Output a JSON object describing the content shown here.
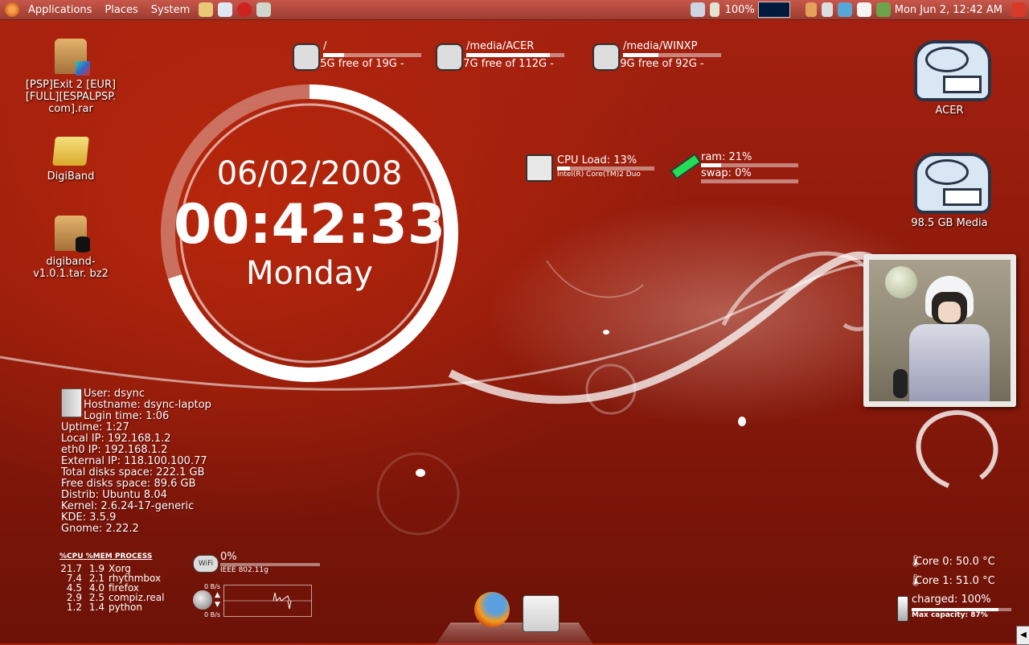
{
  "panel": {
    "menu": [
      "Applications",
      "Places",
      "System"
    ],
    "battery": "100%",
    "clock": "Mon Jun  2, 12:42 AM"
  },
  "desktop_icons": [
    {
      "label": "[PSP]Exit 2 [EUR] [FULL][ESPALPSP. com].rar"
    },
    {
      "label": "DigiBand"
    },
    {
      "label": "digiband-v1.0.1.tar. bz2"
    },
    {
      "label": "ACER"
    },
    {
      "label": "98.5 GB Media"
    }
  ],
  "disks": [
    {
      "path": "/",
      "usage": "15G free of 19G -",
      "used_fraction": 0.21
    },
    {
      "path": "/media/ACER",
      "usage": "17G free of 112G -",
      "used_fraction": 0.85
    },
    {
      "path": "/media/WINXP",
      "usage": "59G free of 92G -",
      "used_fraction": 0.36
    }
  ],
  "clock_widget": {
    "date": "06/02/2008",
    "time": "00:42:33",
    "day": "Monday",
    "ring_fraction": 0.7
  },
  "cpu": {
    "label": "CPU Load: 13%",
    "model": "Intel(R) Core(TM)2 Duo",
    "load_fraction": 0.13
  },
  "memory": {
    "ram": "ram: 21%",
    "swap": "swap: 0%",
    "ram_fraction": 0.21,
    "swap_fraction": 0
  },
  "system_info": [
    "User: dsync",
    "Hostname: dsync-laptop",
    "Login time: 1:06",
    "Uptime: 1:27",
    "Local IP: 192.168.1.2",
    "eth0 IP: 192.168.1.2",
    "External IP: 118.100.100.77",
    "Total disks space: 222.1 GB",
    "Free disks space: 89.6 GB",
    "Distrib: Ubuntu 8.04",
    "Kernel: 2.6.24-17-generic",
    "KDE: 3.5.9",
    "Gnome: 2.22.2"
  ],
  "processes": {
    "header": "%CPU %MEM PROCESS",
    "rows": [
      {
        "cpu": "21.7",
        "mem": "1.9",
        "name": "Xorg"
      },
      {
        "cpu": "7.4",
        "mem": "2.1",
        "name": "rhythmbox"
      },
      {
        "cpu": "4.5",
        "mem": "4.0",
        "name": "firefox"
      },
      {
        "cpu": "2.9",
        "mem": "2.5",
        "name": "compiz.real"
      },
      {
        "cpu": "1.2",
        "mem": "1.4",
        "name": "python"
      }
    ]
  },
  "wifi": {
    "percent": "0%",
    "standard": "IEEE 802.11g",
    "up": "0 B/s",
    "down": "0 B/s"
  },
  "sensors": {
    "core0": "Core 0: 50.0 °C",
    "core1": "Core 1: 51.0 °C",
    "battery": "charged: 100%",
    "capacity": "Max capacity: 87%",
    "battery_fraction": 0.87
  },
  "colors": {
    "panel": "#b44a3e",
    "background": "#9a1d0c",
    "bar": "#ffffff"
  }
}
